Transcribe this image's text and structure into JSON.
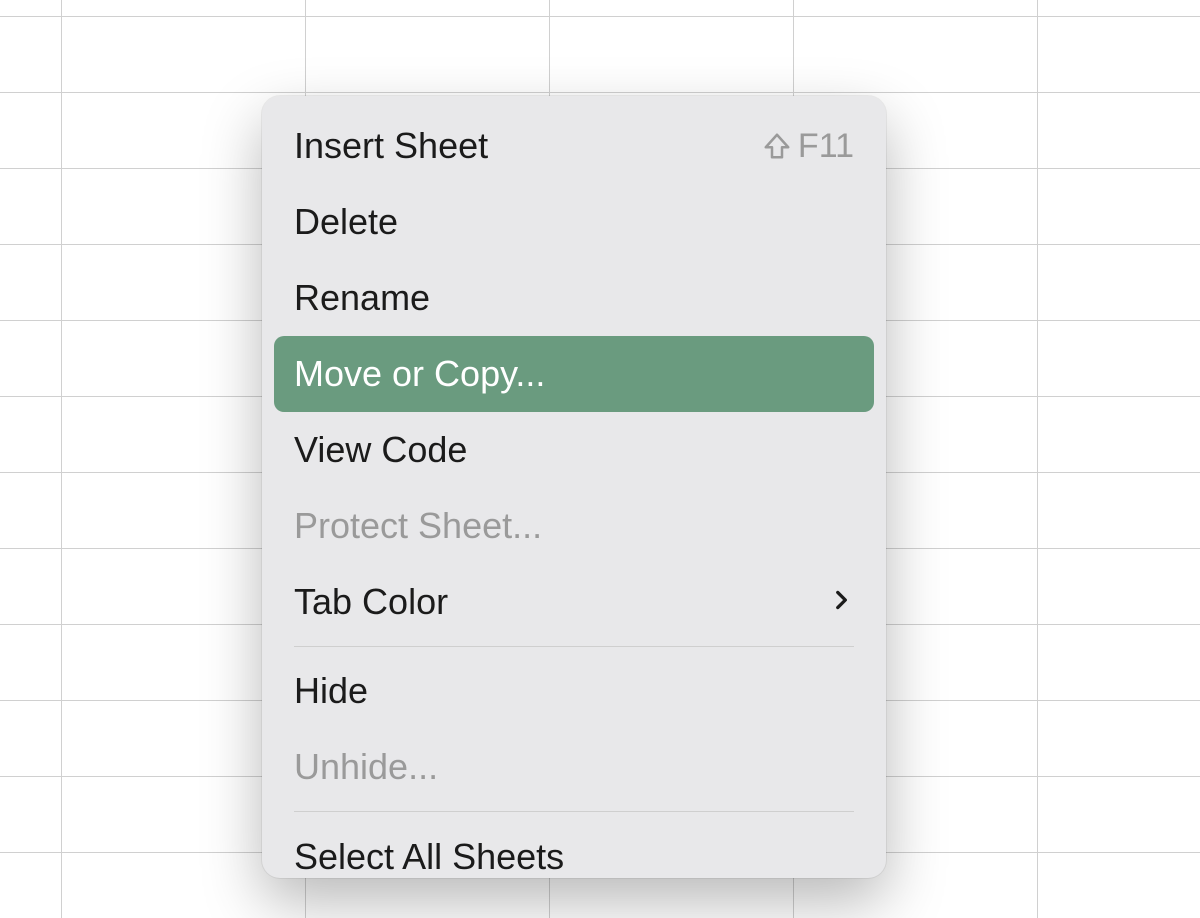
{
  "menu": {
    "insert_sheet": "Insert Sheet",
    "insert_sheet_shortcut": "F11",
    "delete": "Delete",
    "rename": "Rename",
    "move_or_copy": "Move or Copy...",
    "view_code": "View Code",
    "protect_sheet": "Protect Sheet...",
    "tab_color": "Tab Color",
    "hide": "Hide",
    "unhide": "Unhide...",
    "select_all_sheets": "Select All Sheets"
  }
}
